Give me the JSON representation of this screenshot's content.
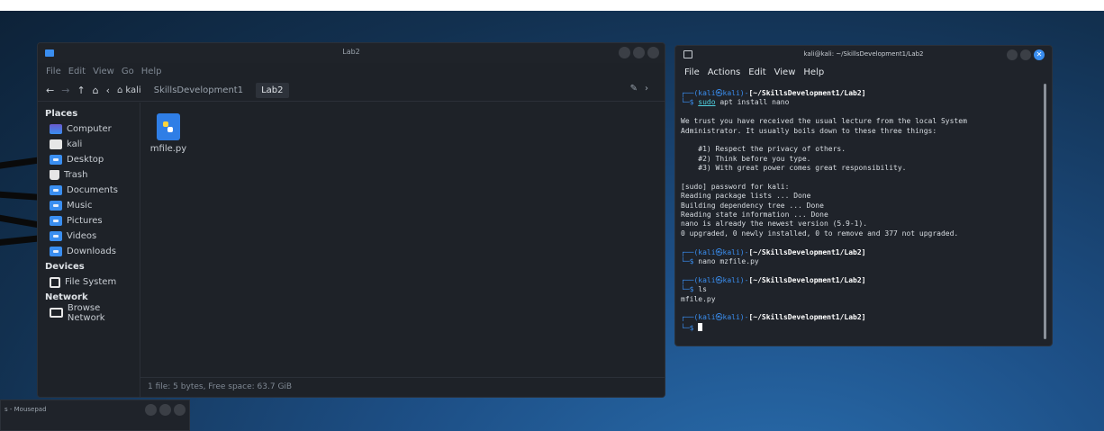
{
  "file_manager": {
    "title": "Lab2",
    "menu": [
      "File",
      "Edit",
      "View",
      "Go",
      "Help"
    ],
    "breadcrumbs": [
      "kali",
      "SkillsDevelopment1",
      "Lab2"
    ],
    "sidebar": {
      "places_header": "Places",
      "places": [
        {
          "label": "Computer",
          "icon": "computer-icon"
        },
        {
          "label": "kali",
          "icon": "home-folder-icon"
        },
        {
          "label": "Desktop",
          "icon": "desktop-folder-icon"
        },
        {
          "label": "Trash",
          "icon": "trash-icon"
        },
        {
          "label": "Documents",
          "icon": "documents-folder-icon"
        },
        {
          "label": "Music",
          "icon": "music-folder-icon"
        },
        {
          "label": "Pictures",
          "icon": "pictures-folder-icon"
        },
        {
          "label": "Videos",
          "icon": "videos-folder-icon"
        },
        {
          "label": "Downloads",
          "icon": "downloads-folder-icon"
        }
      ],
      "devices_header": "Devices",
      "devices": [
        {
          "label": "File System",
          "icon": "drive-icon"
        }
      ],
      "network_header": "Network",
      "network": [
        {
          "label": "Browse Network",
          "icon": "network-icon"
        }
      ]
    },
    "files": [
      {
        "name": "mfile.py",
        "icon": "python-file-icon"
      }
    ],
    "status": "1 file: 5 bytes, Free space: 63.7 GiB"
  },
  "terminal": {
    "title": "kali@kali: ~/SkillsDevelopment1/Lab2",
    "menu": [
      "File",
      "Actions",
      "Edit",
      "View",
      "Help"
    ],
    "prompt_user": "(kali㉿kali)",
    "prompt_path": "[~/SkillsDevelopment1/Lab2]",
    "cmd1_sudo": "sudo",
    "cmd1_rest": " apt install nano",
    "lecture": [
      "We trust you have received the usual lecture from the local System",
      "Administrator. It usually boils down to these three things:",
      "",
      "    #1) Respect the privacy of others.",
      "    #2) Think before you type.",
      "    #3) With great power comes great responsibility.",
      "",
      "[sudo] password for kali:",
      "Reading package lists ... Done",
      "Building dependency tree ... Done",
      "Reading state information ... Done",
      "nano is already the newest version (5.9-1).",
      "0 upgraded, 0 newly installed, 0 to remove and 377 not upgraded."
    ],
    "cmd2": "nano mzfile.py",
    "cmd3": "ls",
    "ls_output": "mfile.py"
  },
  "mousepad": {
    "title": "s - Mousepad"
  },
  "colors": {
    "accent": "#3a8ef0",
    "window_bg": "#1e2228",
    "desktop": "#1d4f86"
  }
}
